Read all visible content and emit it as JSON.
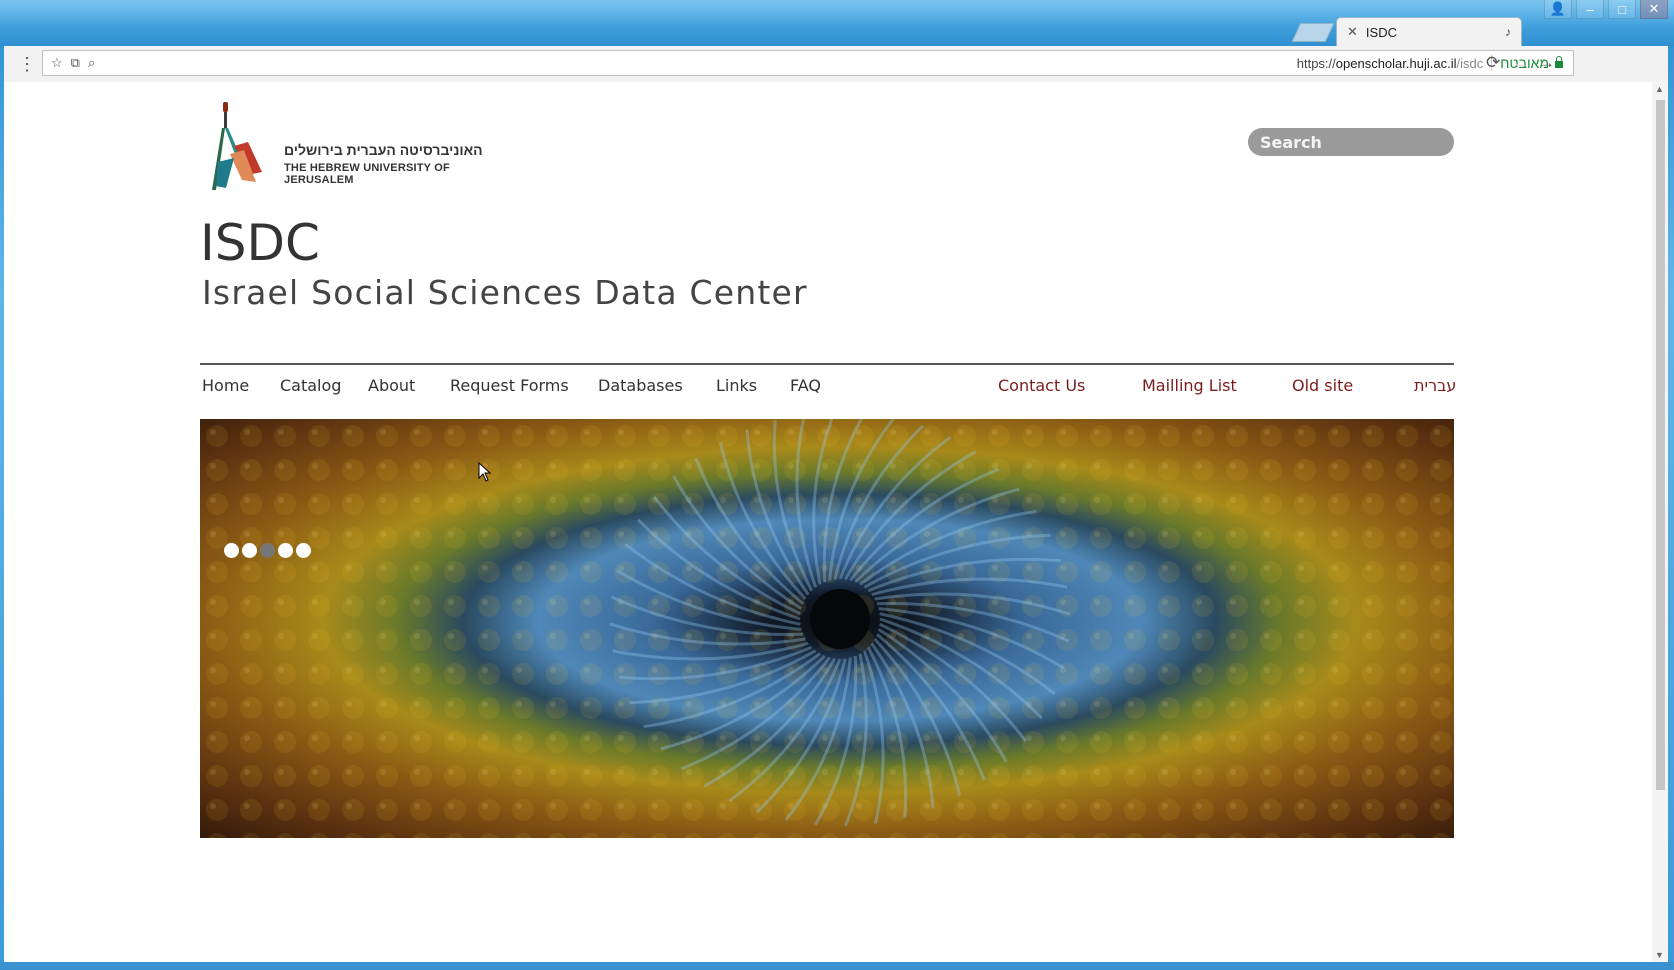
{
  "browser": {
    "tab_title": "ISDC",
    "url_scheme": "https://",
    "url_host": "openscholar.huji.ac.il",
    "url_path": "/isdc",
    "secure_label": "מאובטח"
  },
  "page": {
    "logo_hebrew": "האוניברסיטה העברית בירושלים",
    "logo_english": "THE HEBREW UNIVERSITY OF JERUSALEM",
    "search_placeholder": "Search",
    "site_title": "ISDC",
    "site_subtitle": "Israel Social Sciences Data Center",
    "nav": {
      "home": "Home",
      "catalog": "Catalog",
      "about": "About",
      "request_forms": "Request Forms",
      "databases": "Databases",
      "links": "Links",
      "faq": "FAQ",
      "contact_us": "Contact Us",
      "mailing_list": "Mailling List",
      "old_site": "Old site",
      "hebrew": "עברית"
    },
    "slideshow": {
      "slide_count": 5,
      "active_index": 2
    }
  },
  "colors": {
    "accent_nav": "#7a1c1c",
    "text": "#333333",
    "search_bg": "#9a9a9a",
    "secure_green": "#1a8a3a"
  }
}
